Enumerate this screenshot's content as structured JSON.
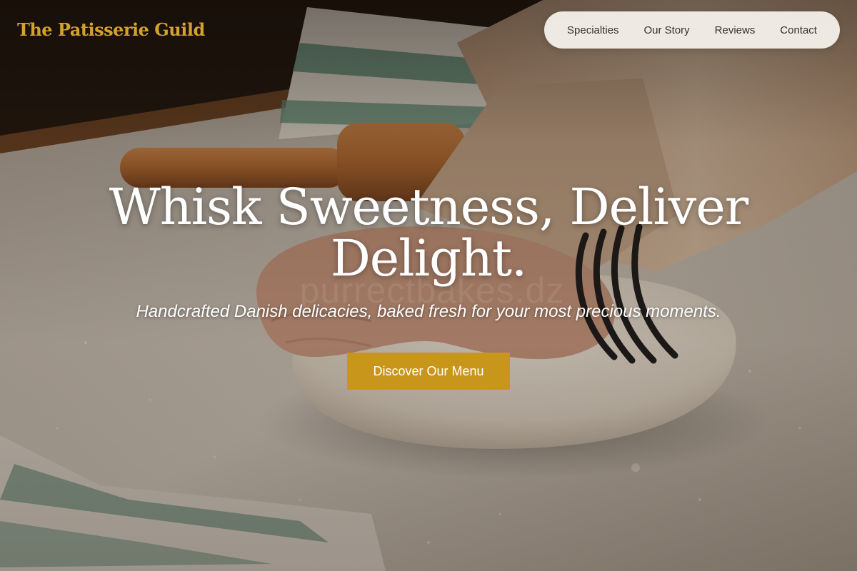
{
  "brand": {
    "name": "The Patisserie Guild"
  },
  "nav": {
    "items": [
      {
        "label": "Specialties"
      },
      {
        "label": "Our Story"
      },
      {
        "label": "Reviews"
      },
      {
        "label": "Contact"
      }
    ]
  },
  "hero": {
    "headline_line1": "Whisk Sweetness, Deliver",
    "headline_line2": "Delight.",
    "tagline": "Handcrafted Danish delicacies, baked fresh for your most precious moments.",
    "cta_label": "Discover Our Menu",
    "watermark": "purrectbakes.dz",
    "background_image": "hands-kneading-dough-on-floured-table"
  },
  "colors": {
    "brand_gold": "#d4a12c",
    "cta_gold": "#c9961c",
    "nav_pill": "#f5f2ec",
    "text_light": "#ffffff"
  }
}
